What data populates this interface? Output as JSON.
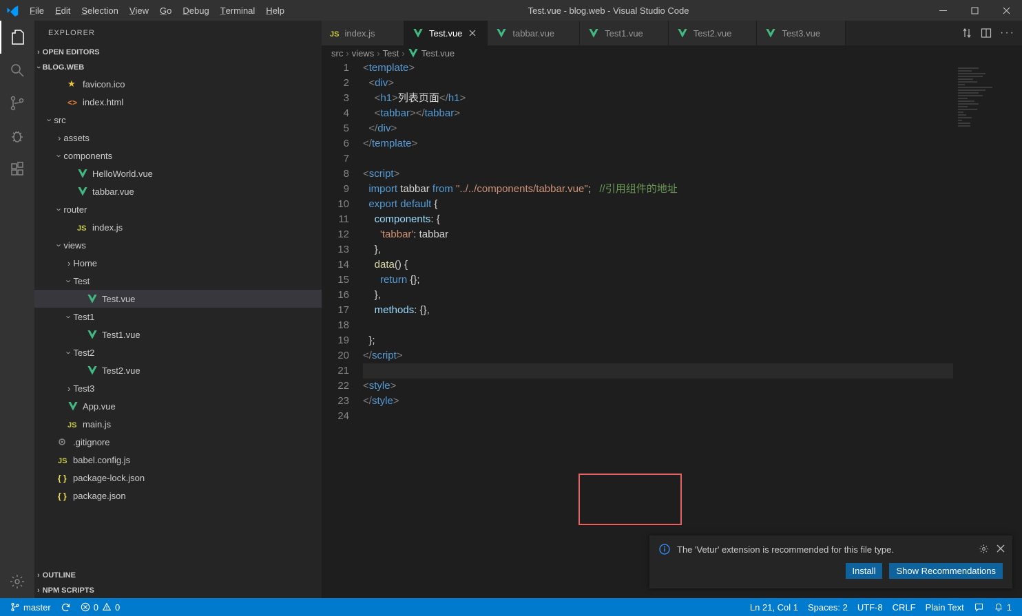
{
  "title": "Test.vue - blog.web - Visual Studio Code",
  "menu": [
    "File",
    "Edit",
    "Selection",
    "View",
    "Go",
    "Debug",
    "Terminal",
    "Help"
  ],
  "activity": [
    "files",
    "search",
    "source-control",
    "debug",
    "extensions"
  ],
  "sidebar": {
    "title": "EXPLORER",
    "sections": {
      "open_editors": "OPEN EDITORS",
      "project": "BLOG.WEB",
      "outline": "OUTLINE",
      "npm": "NPM SCRIPTS"
    },
    "tree": [
      {
        "depth": 1,
        "icon": "star",
        "color": "#e8c63c",
        "label": "favicon.ico"
      },
      {
        "depth": 1,
        "icon": "code",
        "color": "#e37933",
        "label": "index.html"
      },
      {
        "depth": 0,
        "chev": "down",
        "label": "src"
      },
      {
        "depth": 1,
        "chev": "right",
        "label": "assets"
      },
      {
        "depth": 1,
        "chev": "down",
        "label": "components"
      },
      {
        "depth": 2,
        "icon": "vue",
        "color": "#42b883",
        "label": "HelloWorld.vue"
      },
      {
        "depth": 2,
        "icon": "vue",
        "color": "#42b883",
        "label": "tabbar.vue"
      },
      {
        "depth": 1,
        "chev": "down",
        "label": "router"
      },
      {
        "depth": 2,
        "icon": "js",
        "color": "#cbcb41",
        "label": "index.js"
      },
      {
        "depth": 1,
        "chev": "down",
        "label": "views"
      },
      {
        "depth": 2,
        "chev": "right",
        "label": "Home"
      },
      {
        "depth": 2,
        "chev": "down",
        "label": "Test"
      },
      {
        "depth": 3,
        "icon": "vue",
        "color": "#42b883",
        "label": "Test.vue",
        "selected": true
      },
      {
        "depth": 2,
        "chev": "down",
        "label": "Test1"
      },
      {
        "depth": 3,
        "icon": "vue",
        "color": "#42b883",
        "label": "Test1.vue"
      },
      {
        "depth": 2,
        "chev": "down",
        "label": "Test2"
      },
      {
        "depth": 3,
        "icon": "vue",
        "color": "#42b883",
        "label": "Test2.vue"
      },
      {
        "depth": 2,
        "chev": "right",
        "label": "Test3"
      },
      {
        "depth": 1,
        "icon": "vue",
        "color": "#42b883",
        "label": "App.vue"
      },
      {
        "depth": 1,
        "icon": "js",
        "color": "#cbcb41",
        "label": "main.js"
      },
      {
        "depth": 0,
        "icon": "dot",
        "color": "#8a8a8a",
        "label": ".gitignore"
      },
      {
        "depth": 0,
        "icon": "js",
        "color": "#cbcb41",
        "label": "babel.config.js"
      },
      {
        "depth": 0,
        "icon": "json",
        "color": "#f1e05a",
        "label": "package-lock.json"
      },
      {
        "depth": 0,
        "icon": "json",
        "color": "#f1e05a",
        "label": "package.json"
      }
    ]
  },
  "tabs": [
    {
      "icon": "js",
      "color": "#cbcb41",
      "label": "index.js"
    },
    {
      "icon": "vue",
      "color": "#42b883",
      "label": "Test.vue",
      "active": true,
      "close": true
    },
    {
      "icon": "vue",
      "color": "#42b883",
      "label": "tabbar.vue"
    },
    {
      "icon": "vue",
      "color": "#42b883",
      "label": "Test1.vue"
    },
    {
      "icon": "vue",
      "color": "#42b883",
      "label": "Test2.vue"
    },
    {
      "icon": "vue",
      "color": "#42b883",
      "label": "Test3.vue"
    }
  ],
  "breadcrumbs": [
    "src",
    "views",
    "Test",
    "Test.vue"
  ],
  "code": {
    "lines": [
      [
        [
          "brkt",
          "<"
        ],
        [
          "tag",
          "template"
        ],
        [
          "brkt",
          ">"
        ]
      ],
      [
        [
          "",
          "  "
        ],
        [
          "brkt",
          "<"
        ],
        [
          "tag",
          "div"
        ],
        [
          "brkt",
          ">"
        ]
      ],
      [
        [
          "",
          "    "
        ],
        [
          "brkt",
          "<"
        ],
        [
          "tag",
          "h1"
        ],
        [
          "brkt",
          ">"
        ],
        [
          "",
          "列表页面"
        ],
        [
          "brkt",
          "</"
        ],
        [
          "tag",
          "h1"
        ],
        [
          "brkt",
          ">"
        ]
      ],
      [
        [
          "",
          "    "
        ],
        [
          "brkt",
          "<"
        ],
        [
          "tag",
          "tabbar"
        ],
        [
          "brkt",
          "></"
        ],
        [
          "tag",
          "tabbar"
        ],
        [
          "brkt",
          ">"
        ]
      ],
      [
        [
          "",
          "  "
        ],
        [
          "brkt",
          "</"
        ],
        [
          "tag",
          "div"
        ],
        [
          "brkt",
          ">"
        ]
      ],
      [
        [
          "brkt",
          "</"
        ],
        [
          "tag",
          "template"
        ],
        [
          "brkt",
          ">"
        ]
      ],
      [
        [
          "",
          ""
        ]
      ],
      [
        [
          "brkt",
          "<"
        ],
        [
          "tag",
          "script"
        ],
        [
          "brkt",
          ">"
        ]
      ],
      [
        [
          "",
          "  "
        ],
        [
          "kw",
          "import"
        ],
        [
          "",
          " tabbar "
        ],
        [
          "kw",
          "from"
        ],
        [
          "",
          " "
        ],
        [
          "str",
          "\"../../components/tabbar.vue\""
        ],
        [
          "",
          ";   "
        ],
        [
          "comment",
          "//引用组件的地址"
        ]
      ],
      [
        [
          "",
          "  "
        ],
        [
          "kw",
          "export"
        ],
        [
          "",
          " "
        ],
        [
          "kw",
          "default"
        ],
        [
          "",
          " {"
        ]
      ],
      [
        [
          "",
          "    "
        ],
        [
          "ident",
          "components"
        ],
        [
          "",
          ": {"
        ]
      ],
      [
        [
          "",
          "      "
        ],
        [
          "str",
          "'tabbar'"
        ],
        [
          "",
          ": tabbar"
        ]
      ],
      [
        [
          "",
          "    },"
        ]
      ],
      [
        [
          "",
          "    "
        ],
        [
          "fn",
          "data"
        ],
        [
          "",
          "() {"
        ]
      ],
      [
        [
          "",
          "      "
        ],
        [
          "kw",
          "return"
        ],
        [
          "",
          " {};"
        ]
      ],
      [
        [
          "",
          "    },"
        ]
      ],
      [
        [
          "",
          "    "
        ],
        [
          "ident",
          "methods"
        ],
        [
          "",
          ": {},"
        ]
      ],
      [
        [
          "",
          ""
        ]
      ],
      [
        [
          "",
          "  };"
        ]
      ],
      [
        [
          "brkt",
          "</"
        ],
        [
          "tag",
          "script"
        ],
        [
          "brkt",
          ">"
        ]
      ],
      [
        [
          "",
          ""
        ]
      ],
      [
        [
          "brkt",
          "<"
        ],
        [
          "tag",
          "style"
        ],
        [
          "brkt",
          ">"
        ]
      ],
      [
        [
          "brkt",
          "</"
        ],
        [
          "tag",
          "style"
        ],
        [
          "brkt",
          ">"
        ]
      ],
      [
        [
          "",
          ""
        ]
      ]
    ],
    "highlight_line": 21
  },
  "notification": {
    "message": "The 'Vetur' extension is recommended for this file type.",
    "install": "Install",
    "show": "Show Recommendations"
  },
  "status": {
    "branch": "master",
    "errors": "0",
    "warnings": "0",
    "position": "Ln 21, Col 1",
    "spaces": "Spaces: 2",
    "encoding": "UTF-8",
    "eol": "CRLF",
    "mode": "Plain Text",
    "notif_count": "1"
  }
}
